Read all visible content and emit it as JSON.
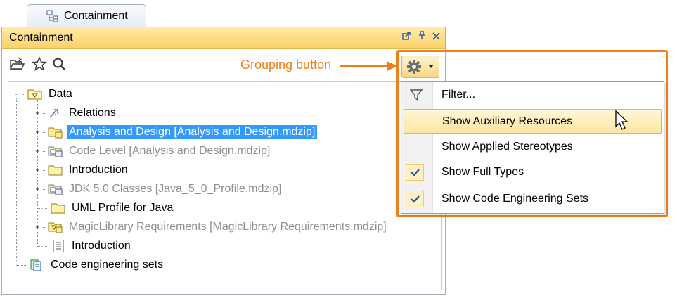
{
  "tab": {
    "label": "Containment",
    "icon": "containment-tree-icon"
  },
  "panel": {
    "title": "Containment",
    "title_controls": [
      "float-icon",
      "pin-icon",
      "close-icon"
    ],
    "toolbar_icons": [
      "open-folder-icon",
      "favorite-star-icon",
      "search-icon"
    ]
  },
  "tree": {
    "root": {
      "label": "Data",
      "icon": "package-icon"
    },
    "children": [
      {
        "label": "Relations",
        "icon": "relations-icon",
        "style": "normal"
      },
      {
        "label": "Analysis and Design [Analysis and Design.mdzip]",
        "icon": "shared-package-icon",
        "style": "selected"
      },
      {
        "label": "Code Level [Analysis and Design.mdzip]",
        "icon": "shared-model-icon",
        "style": "grey"
      },
      {
        "label": "Introduction",
        "icon": "folder-icon",
        "style": "normal"
      },
      {
        "label": "JDK 5.0 Classes [Java_5_0_Profile.mdzip]",
        "icon": "shared-model-icon",
        "style": "grey"
      },
      {
        "label": "UML Profile for Java",
        "icon": "folder-icon",
        "style": "normal"
      },
      {
        "label": "MagicLibrary Requirements [MagicLibrary Requirements.mdzip]",
        "icon": "shared-package-icon",
        "style": "grey"
      },
      {
        "label": "Introduction",
        "icon": "document-icon",
        "style": "normal"
      }
    ],
    "second_root": {
      "label": "Code engineering sets",
      "icon": "code-engineering-icon"
    }
  },
  "annotation": {
    "text": "Grouping button",
    "color": "#f07e1a"
  },
  "grouping_button": {
    "icon": "gear-icon",
    "dropdown": "chevron-down-icon"
  },
  "menu": {
    "items": [
      {
        "label": "Filter...",
        "icon": "filter-icon",
        "checked": false,
        "highlighted": false
      },
      {
        "label": "Show Auxiliary Resources",
        "checked": false,
        "highlighted": true
      },
      {
        "label": "Show Applied Stereotypes",
        "checked": false,
        "highlighted": false
      },
      {
        "label": "Show Full Types",
        "checked": true,
        "highlighted": false
      },
      {
        "label": "Show Code Engineering Sets",
        "checked": true,
        "highlighted": false
      }
    ]
  },
  "colors": {
    "accent": "#f07e1a",
    "selection": "#3399ff",
    "titlebar": "#fcd16a"
  }
}
